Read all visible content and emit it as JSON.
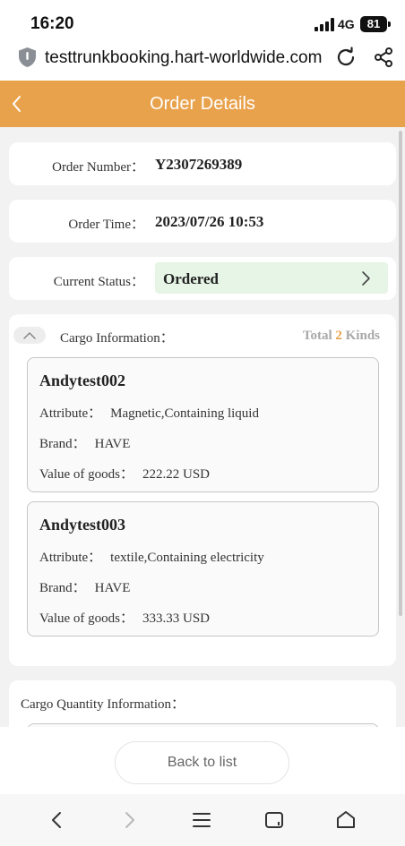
{
  "status_bar": {
    "time": "16:20",
    "network": "4G",
    "battery": "81"
  },
  "url_bar": {
    "url": "testtrunkbooking.hart-worldwide.com"
  },
  "header": {
    "title": "Order Details"
  },
  "order": {
    "number_label": "Order Number：",
    "number": "Y2307269389",
    "time_label": "Order Time：",
    "time": "2023/07/26 10:53",
    "status_label": "Current Status：",
    "status": "Ordered"
  },
  "cargo": {
    "title": "Cargo Information：",
    "total_prefix": "Total",
    "total_count": "2",
    "total_suffix": "Kinds",
    "items": [
      {
        "name": "Andytest002",
        "attribute_label": "Attribute：",
        "attribute": "Magnetic,Containing liquid",
        "brand_label": "Brand：",
        "brand": "HAVE",
        "value_label": "Value of goods：",
        "value": "222.22 USD"
      },
      {
        "name": "Andytest003",
        "attribute_label": "Attribute：",
        "attribute": "textile,Containing electricity",
        "brand_label": "Brand：",
        "brand": "HAVE",
        "value_label": "Value of goods：",
        "value": "333.33 USD"
      }
    ]
  },
  "quantity": {
    "title": "Cargo Quantity Information："
  },
  "footer": {
    "back_label": "Back to list"
  },
  "colors": {
    "accent": "#e9a24c",
    "status_bg": "#e6f5e6"
  },
  "icons": {
    "url": "shield-icon",
    "reload": "reload-icon",
    "share": "share-icon",
    "back": "chevron-left-icon",
    "status": "chevron-right-icon",
    "collapse": "chevron-up-icon",
    "nav": [
      "back-arrow-icon",
      "forward-arrow-icon",
      "menu-icon",
      "tabs-icon",
      "home-icon"
    ]
  }
}
